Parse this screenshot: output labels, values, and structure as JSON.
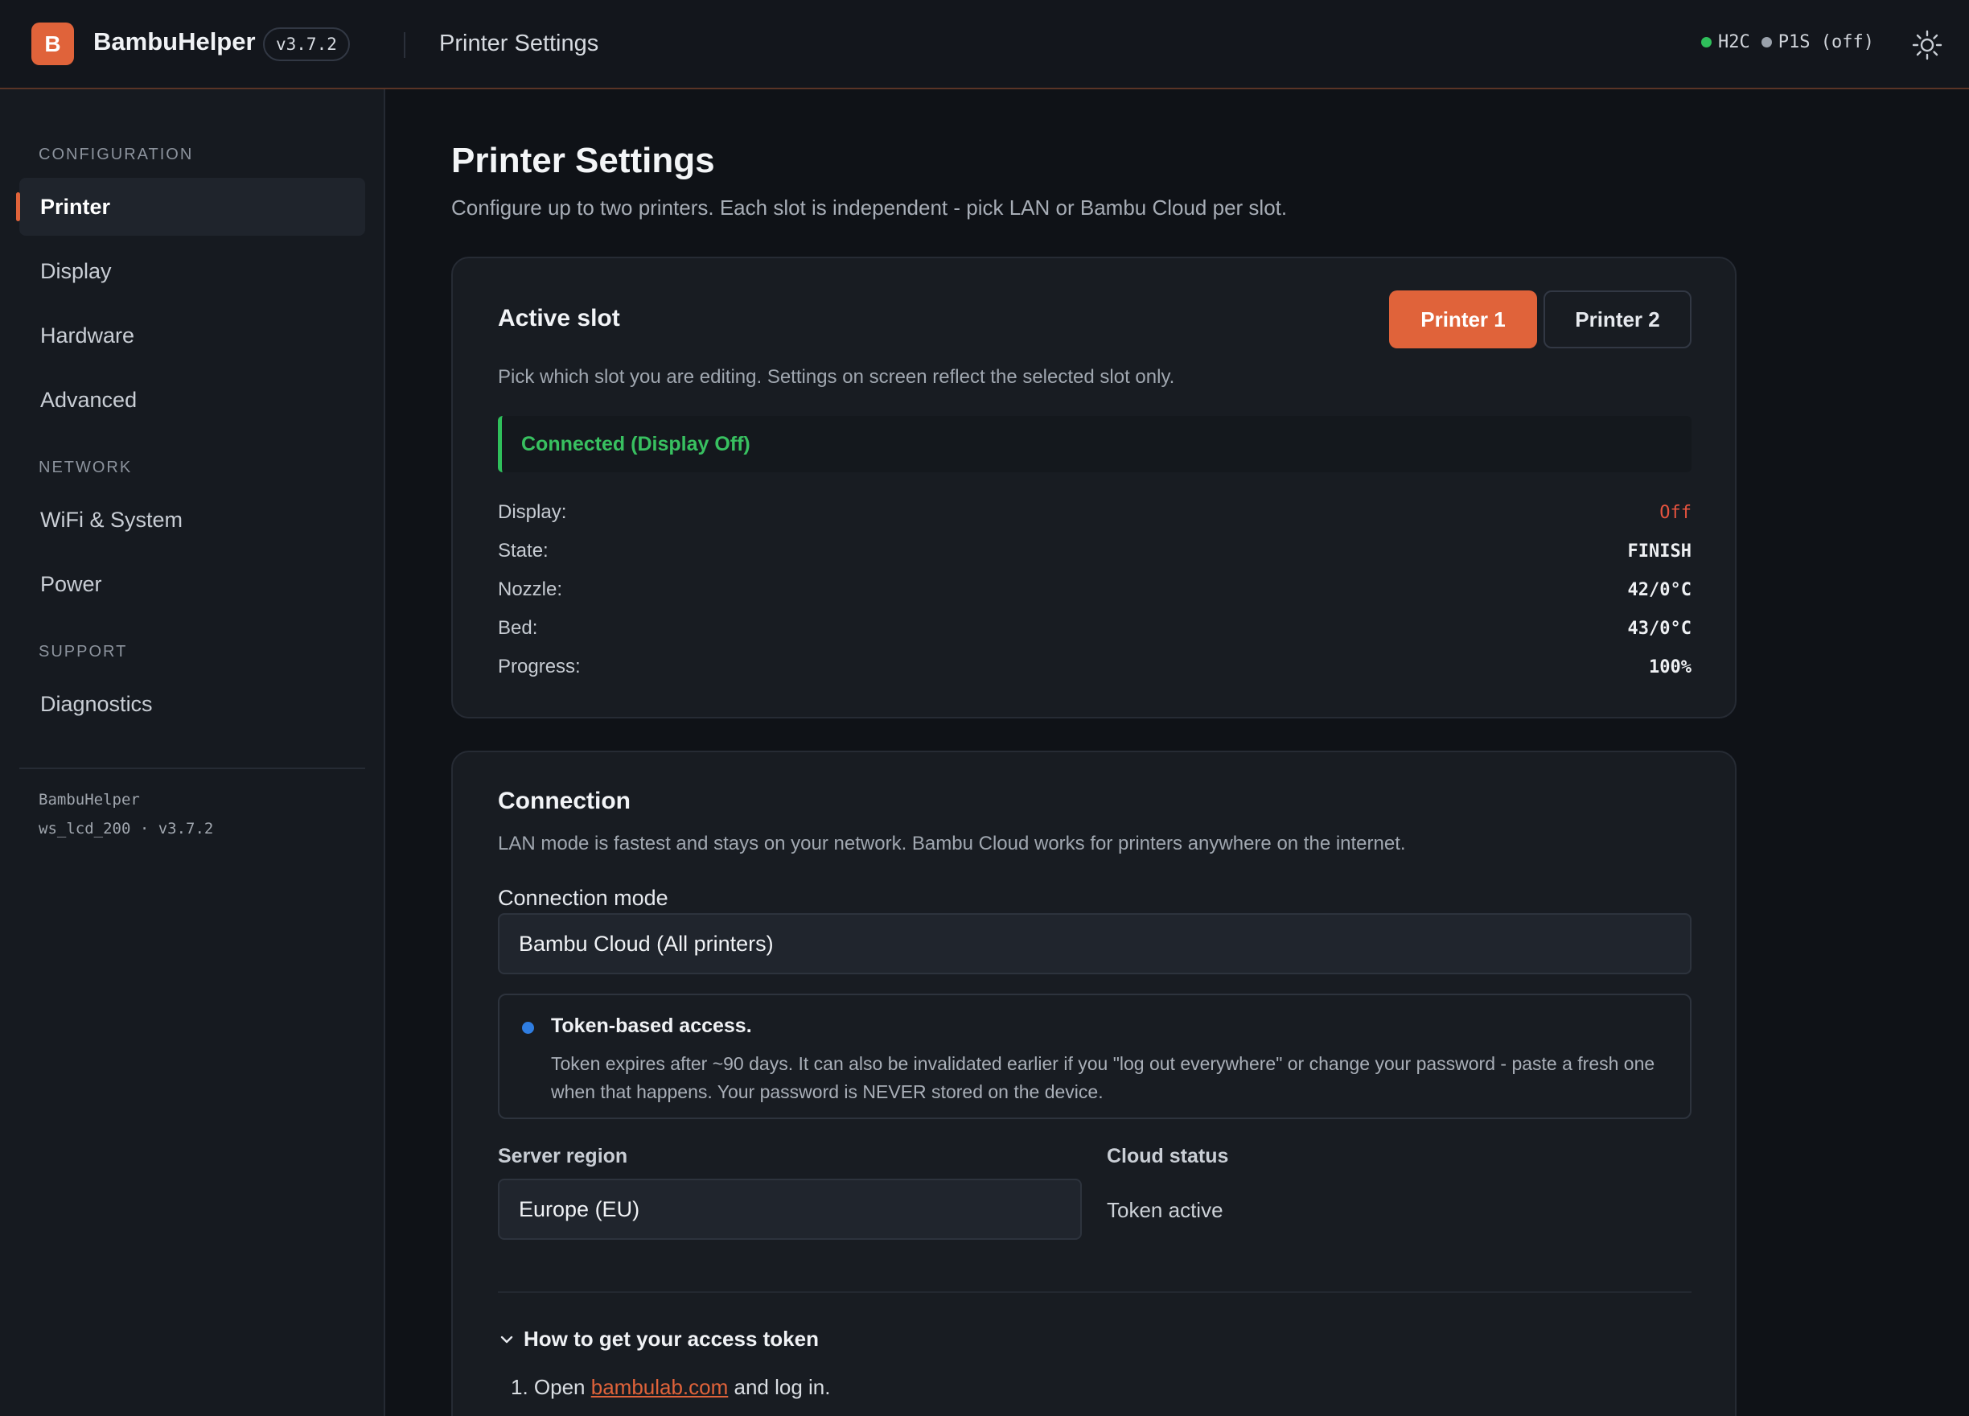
{
  "header": {
    "logo_letter": "B",
    "app_name": "BambuHelper",
    "version": "v3.7.2",
    "page_title": "Printer Settings",
    "status": [
      {
        "label": "H2C",
        "color": "#2fbf5b"
      },
      {
        "label": "P1S (off)",
        "color": "#9aa1ab"
      }
    ],
    "theme_icon": "sun-icon"
  },
  "sidebar": {
    "sections": [
      {
        "title": "CONFIGURATION",
        "items": [
          "Printer",
          "Display",
          "Hardware",
          "Advanced"
        ]
      },
      {
        "title": "NETWORK",
        "items": [
          "WiFi & System",
          "Power"
        ]
      },
      {
        "title": "SUPPORT",
        "items": [
          "Diagnostics"
        ]
      }
    ],
    "active_item": "Printer",
    "footer_line1": "BambuHelper",
    "footer_line2": "ws_lcd_200 · v3.7.2"
  },
  "main": {
    "title": "Printer Settings",
    "subtitle": "Configure up to two printers. Each slot is independent - pick LAN or Bambu Cloud per slot.",
    "active_slot": {
      "title": "Active slot",
      "desc": "Pick which slot you are editing. Settings on screen reflect the selected slot only.",
      "buttons": [
        "Printer 1",
        "Printer 2"
      ],
      "selected": "Printer 1",
      "status_banner": "Connected (Display Off)",
      "rows": [
        {
          "label": "Display:",
          "value": "Off"
        },
        {
          "label": "State:",
          "value": "FINISH"
        },
        {
          "label": "Nozzle:",
          "value": "42/0°C"
        },
        {
          "label": "Bed:",
          "value": "43/0°C"
        },
        {
          "label": "Progress:",
          "value": "100%"
        }
      ]
    },
    "connection": {
      "title": "Connection",
      "desc": "LAN mode is fastest and stays on your network. Bambu Cloud works for printers anywhere on the internet.",
      "mode_label": "Connection mode",
      "mode_value": "Bambu Cloud (All printers)",
      "info_title": "Token-based access.",
      "info_body": "Token expires after ~90 days. It can also be invalidated earlier if you \"log out everywhere\" or change your password - paste a fresh one when that happens. Your password is NEVER stored on the device.",
      "region_label": "Server region",
      "region_value": "Europe (EU)",
      "cloud_status_label": "Cloud status",
      "cloud_status_value": "Token active",
      "howto_title": "How to get your access token",
      "step1_prefix": "1. Open ",
      "step1_link": "bambulab.com",
      "step1_suffix": " and log in."
    }
  },
  "colors": {
    "accent": "#e0633a",
    "success": "#2fbf5b",
    "danger": "#e5533f",
    "info": "#2f7de1"
  }
}
